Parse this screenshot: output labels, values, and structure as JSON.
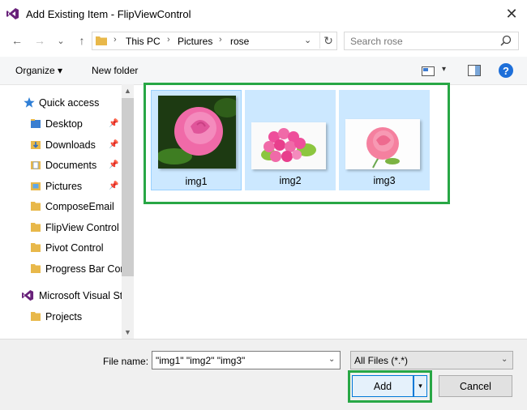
{
  "window": {
    "title": "Add Existing Item - FlipViewControl",
    "close_glyph": "✕"
  },
  "nav": {
    "back": "←",
    "forward": "→",
    "recent": "⌄",
    "up": "↑"
  },
  "address": {
    "crumbs": [
      "This PC",
      "Pictures",
      "rose"
    ],
    "sep": "›",
    "dropdown": "⌄",
    "refresh": "↻"
  },
  "search": {
    "placeholder": "Search rose"
  },
  "toolbar": {
    "organize": "Organize ▾",
    "new_folder": "New folder",
    "view_dd": "▾",
    "help": "?"
  },
  "sidebar": {
    "items": [
      {
        "label": "Quick access",
        "icon": "star-icon",
        "pinned": false
      },
      {
        "label": "Desktop",
        "icon": "desktop-folder-icon",
        "pinned": true
      },
      {
        "label": "Downloads",
        "icon": "downloads-folder-icon",
        "pinned": true
      },
      {
        "label": "Documents",
        "icon": "documents-folder-icon",
        "pinned": true
      },
      {
        "label": "Pictures",
        "icon": "pictures-folder-icon",
        "pinned": true
      },
      {
        "label": "ComposeEmail",
        "icon": "folder-icon",
        "pinned": false
      },
      {
        "label": "FlipView Control",
        "icon": "folder-icon",
        "pinned": false
      },
      {
        "label": "Pivot Control",
        "icon": "folder-icon",
        "pinned": false
      },
      {
        "label": "Progress Bar Control",
        "icon": "folder-icon",
        "pinned": false
      },
      {
        "label": "Microsoft Visual Studio",
        "icon": "visual-studio-icon",
        "pinned": false
      },
      {
        "label": "Projects",
        "icon": "folder-icon",
        "pinned": false
      }
    ],
    "pin_glyph": "📌"
  },
  "files": [
    {
      "name": "img1",
      "thumb": "rose-closeup-dark"
    },
    {
      "name": "img2",
      "thumb": "rose-bouquet"
    },
    {
      "name": "img3",
      "thumb": "single-rose"
    }
  ],
  "bottom": {
    "file_name_label": "File name:",
    "file_name_value": "\"img1\" \"img2\" \"img3\"",
    "filter": "All Files (*.*)",
    "add": "Add",
    "add_dd": "▾",
    "cancel": "Cancel"
  },
  "colors": {
    "accent": "#0078d7",
    "selection": "#cce8ff",
    "annotation": "#28a745"
  }
}
